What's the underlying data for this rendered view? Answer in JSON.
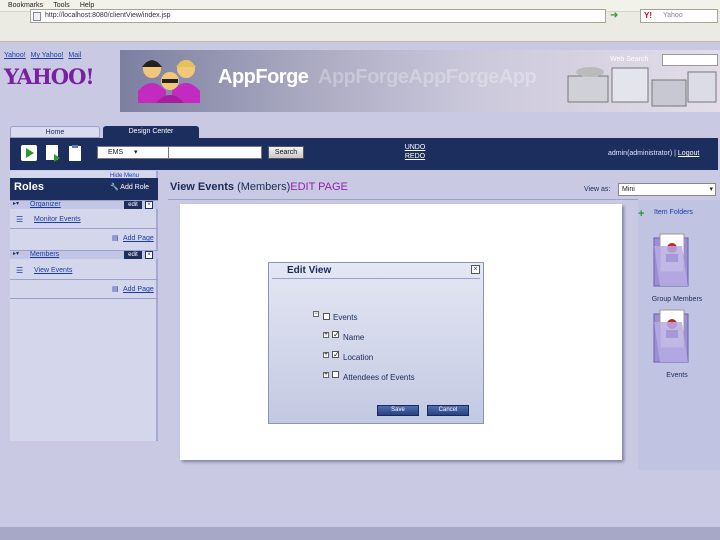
{
  "browser": {
    "menu": [
      "Bookmarks",
      "Tools",
      "Help"
    ],
    "url": "http://localhost:8080/clientView/index.jsp",
    "search_engine": "Y!",
    "search_placeholder": "Yahoo"
  },
  "header": {
    "yahoo_links": [
      "Yahoo!",
      "My Yahoo!",
      "Mail"
    ],
    "logo": "YAHOO!",
    "brand": "AppForge",
    "brand_ghost": "AppForgeAppForgeApp",
    "web_search_label": "Web Search"
  },
  "tabs": [
    {
      "label": "Home"
    },
    {
      "label": "Design Center"
    }
  ],
  "toolbar": {
    "app_select": "EMS",
    "search_button": "Search",
    "undo": "UNDO",
    "redo": "REDO",
    "user_text": "admin(administrator) |",
    "logout": "Logout"
  },
  "sidebar": {
    "hide_menu": "Hide Menu",
    "title": "Roles",
    "add_role": "Add Role",
    "sections": [
      {
        "label": "Organizer",
        "edit": "edit",
        "item": "Monitor Events",
        "add_page": "Add Page"
      },
      {
        "label": "Members",
        "edit": "edit",
        "item": "View Events",
        "add_page": "Add Page"
      }
    ]
  },
  "content": {
    "title": "View Events",
    "role": "(Members)",
    "edit_page": "EDIT PAGE",
    "view_as_label": "View as:",
    "view_as_value": "Mini"
  },
  "dialog": {
    "title": "Edit View",
    "tree": [
      {
        "label": "Events",
        "checked": false
      },
      {
        "label": "Name",
        "checked": true
      },
      {
        "label": "Location",
        "checked": true
      },
      {
        "label": "Attendees of Events",
        "checked": false
      }
    ],
    "save": "Save",
    "cancel": "Cancel"
  },
  "right_panel": {
    "item_folders": "Item Folders",
    "folders": [
      {
        "label": "Group Members"
      },
      {
        "label": "Events"
      }
    ]
  },
  "colors": {
    "nav": "#1c2e5e",
    "accent": "#8e24aa",
    "sidebar": "#d4d6ec"
  }
}
